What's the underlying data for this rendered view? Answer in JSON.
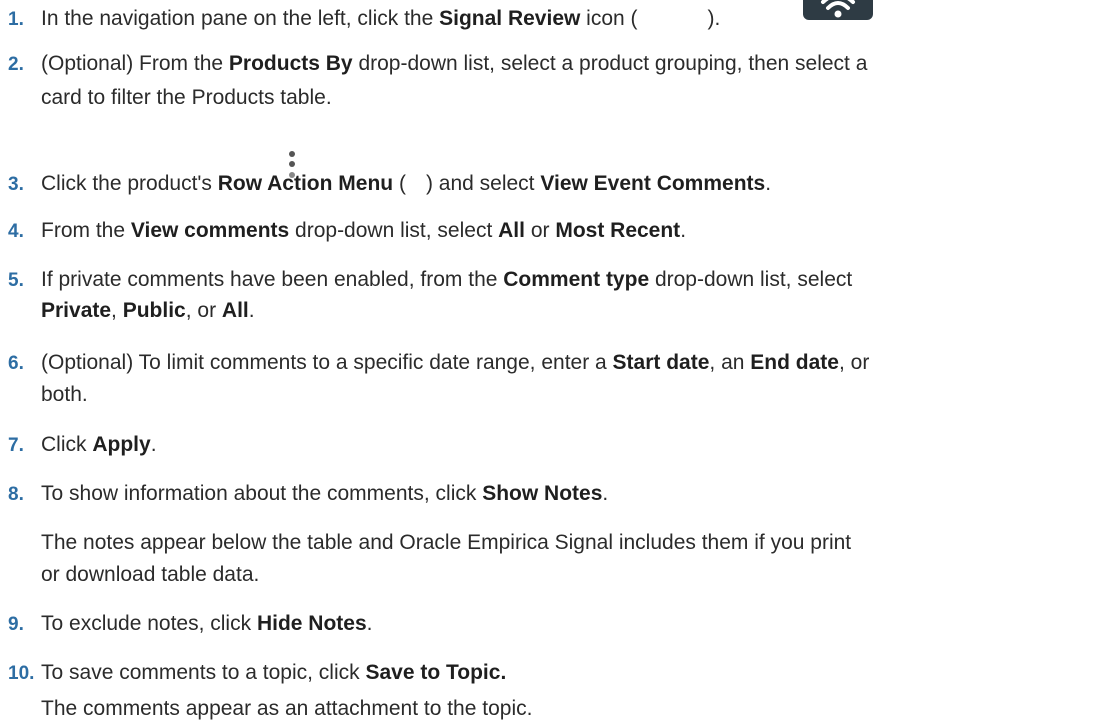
{
  "steps": [
    {
      "num": "1.",
      "text": "In the navigation pane on the left, click the ",
      "bold": "Signal Review",
      "after": " icon (",
      "tail": ")."
    },
    {
      "num": "2.",
      "l1a": "(Optional) From the ",
      "l1b": "Products By",
      "l1c": " drop-down list, select a product grouping, then select a",
      "l2": "card to filter the Products table."
    },
    {
      "num": "3.",
      "a": "Click the product's ",
      "b": "Row Action Menu",
      "c": " (",
      "d": ") and select ",
      "e": "View Event Comments",
      "f": "."
    },
    {
      "num": "4.",
      "a": "From the ",
      "b": "View comments",
      "c": " drop-down list, select ",
      "d": "All",
      "e": " or ",
      "f": "Most Recent",
      "g": "."
    },
    {
      "num": "5.",
      "l1a": "If private comments have been enabled, from the ",
      "l1b": "Comment type",
      "l1c": " drop-down list, select",
      "l2a": "Private",
      "l2b": ", ",
      "l2c": "Public",
      "l2d": ", or ",
      "l2e": "All",
      "l2f": "."
    },
    {
      "num": "6.",
      "l1a": "(Optional) To limit comments to a specific date range, enter a ",
      "l1b": "Start date",
      "l1c": ", an ",
      "l1d": "End date",
      "l1e": ", or",
      "l2": "both."
    },
    {
      "num": "7.",
      "a": "Click ",
      "b": "Apply",
      "c": "."
    },
    {
      "num": "8.",
      "a": "To show information about the comments, click ",
      "b": "Show Notes",
      "c": ".",
      "note1": "The notes appear below the table and Oracle Empirica Signal includes them if you print",
      "note2": "or download table data."
    },
    {
      "num": "9.",
      "a": "To exclude notes, click ",
      "b": "Hide Notes",
      "c": "."
    },
    {
      "num": "10.",
      "a": "To save comments to a topic, click ",
      "b": "Save to Topic.",
      "note": "The comments appear as an attachment to the topic."
    }
  ],
  "icons": {
    "signal_review": "wifi-icon",
    "row_action": "kebab-menu-icon"
  },
  "colors": {
    "step_number": "#2d6da3",
    "text": "#2b2b2b",
    "icon_bg": "#2e3b44"
  }
}
